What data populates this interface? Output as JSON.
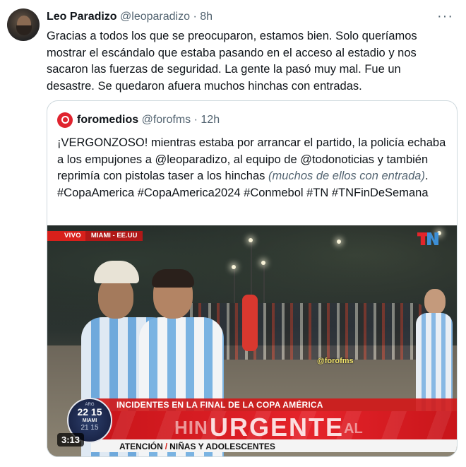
{
  "tweet": {
    "author": "Leo Paradizo",
    "handle": "@leoparadizo",
    "separator": "·",
    "time": "8h",
    "more": "···",
    "text": "Gracias a todos los que se preocuparon, estamos bien. Solo queríamos mostrar el escándalo que estaba pasando en el acceso al estadio y nos sacaron las fuerzas de seguridad. La gente la pasó muy mal. Fue un desastre. Se quedaron afuera muchos hinchas con entradas."
  },
  "quote": {
    "author": "foromedios",
    "handle": "@forofms",
    "separator": "·",
    "time": "12h",
    "text_main": "¡VERGONZOSO! mientras estaba por arrancar el partido, la policía echaba a los empujones a @leoparadizo, al equipo de @todonoticias y también reprimía con pistolas taser a los hinchas ",
    "text_italic": "(muchos de ellos con entrada)",
    "text_tail": ". #CopaAmerica #CopaAmerica2024 #Conmebol #TN #TNFinDeSemana"
  },
  "video": {
    "live_label": "VIVO",
    "location": "MIAMI - EE.UU",
    "watermark": "@forofms",
    "lower_title": "INCIDENTES EN LA FINAL DE LA COPA AMÉRICA",
    "urgent_prefix": "HIN",
    "urgent_word": "URGENTE",
    "urgent_suffix": "AL",
    "ticker_label": "ATENCIÓN",
    "ticker_sep": "/",
    "ticker_text": "NIÑAS Y ADOLESCENTES",
    "clock_top": "ARG",
    "clock_time": "22 15",
    "clock_city": "MIAMI",
    "clock_sub": "21 15",
    "duration": "3:13"
  },
  "colors": {
    "brand_red": "#d8201b",
    "text_secondary": "#536471",
    "border": "#cfd9de"
  }
}
